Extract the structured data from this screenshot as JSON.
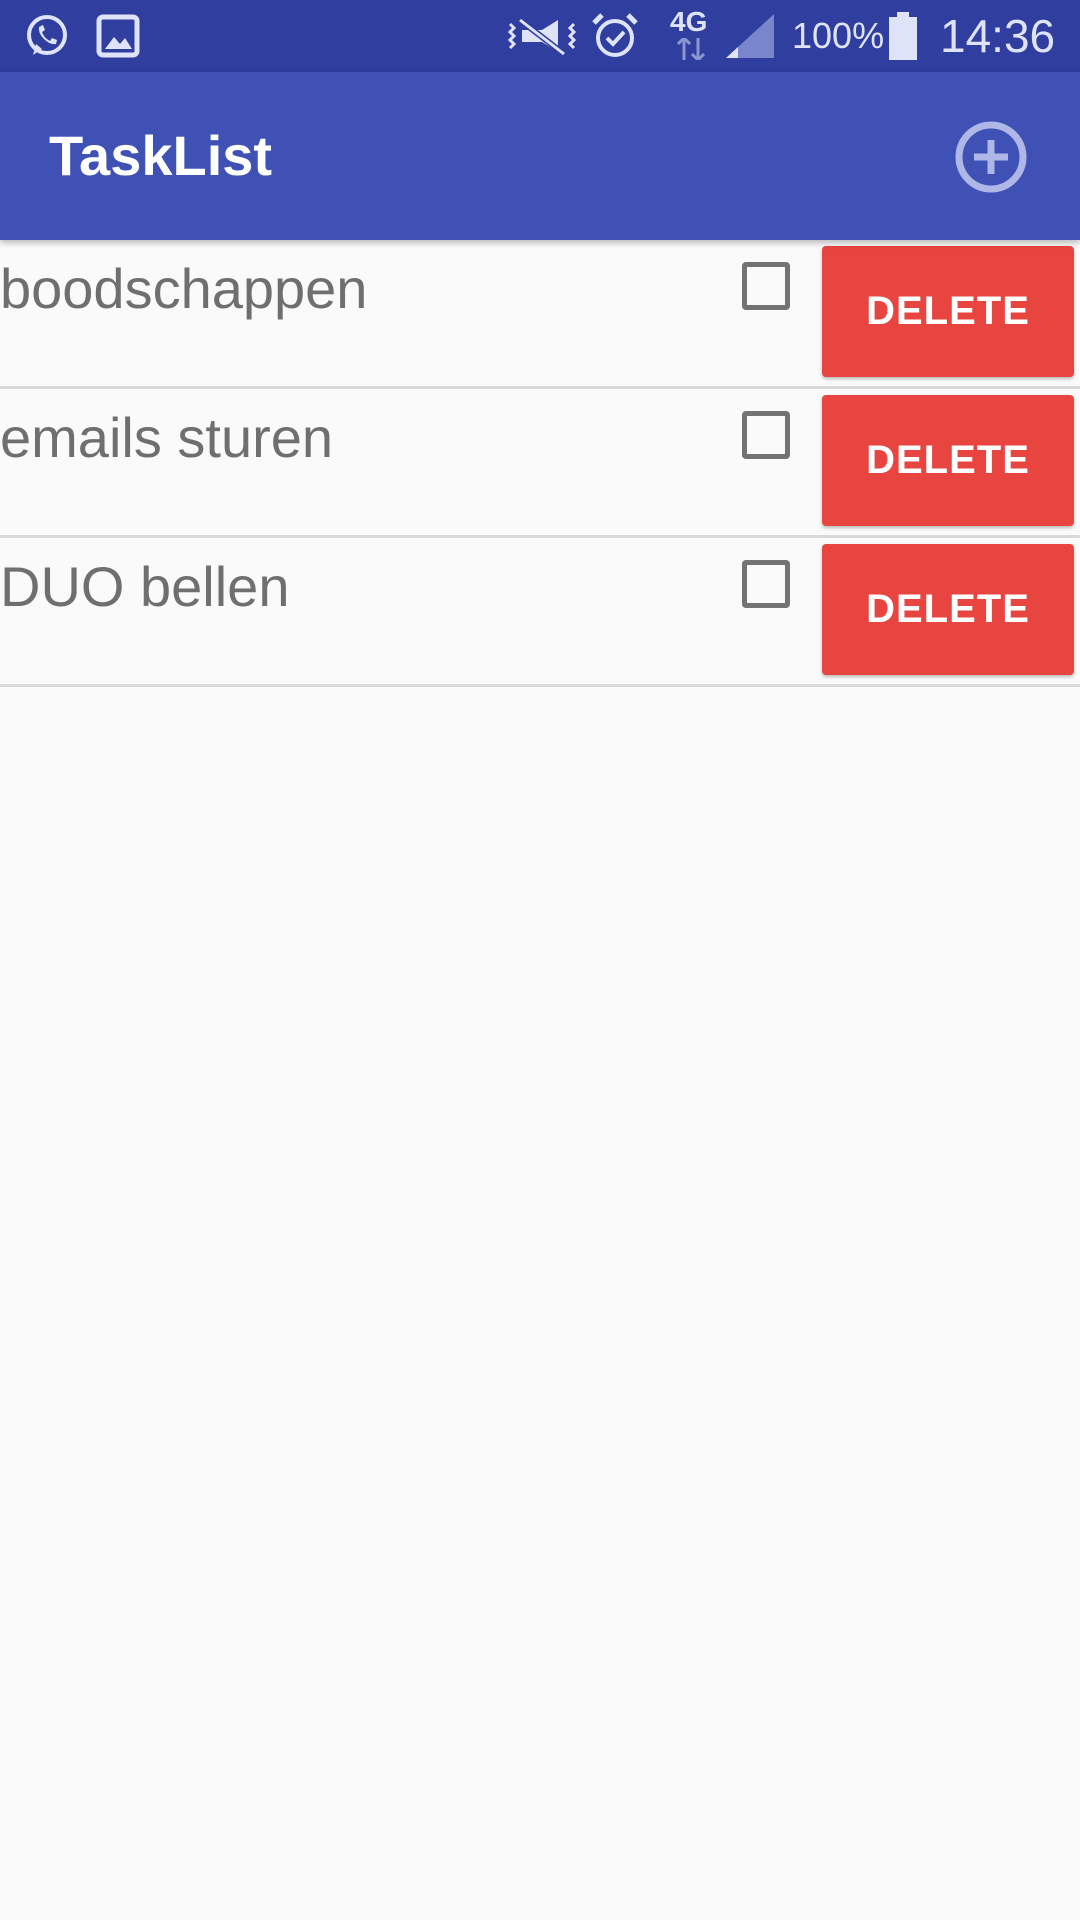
{
  "status_bar": {
    "battery_percent": "100%",
    "network_type": "4G",
    "time": "14:36",
    "icons": [
      "whatsapp-icon",
      "gallery-icon",
      "vibrate-mute-icon",
      "alarm-icon",
      "network-4g-icon",
      "signal-icon",
      "battery-icon"
    ]
  },
  "app_bar": {
    "title": "TaskList",
    "add_icon": "add-circle-icon"
  },
  "tasks": [
    {
      "label": "boodschappen",
      "checked": false,
      "delete_label": "DELETE"
    },
    {
      "label": "emails sturen",
      "checked": false,
      "delete_label": "DELETE"
    },
    {
      "label": "DUO bellen",
      "checked": false,
      "delete_label": "DELETE"
    }
  ],
  "colors": {
    "status_bar": "#303f9f",
    "app_bar": "#3f51b5",
    "delete_button": "#e84541",
    "background": "#fafafa"
  }
}
